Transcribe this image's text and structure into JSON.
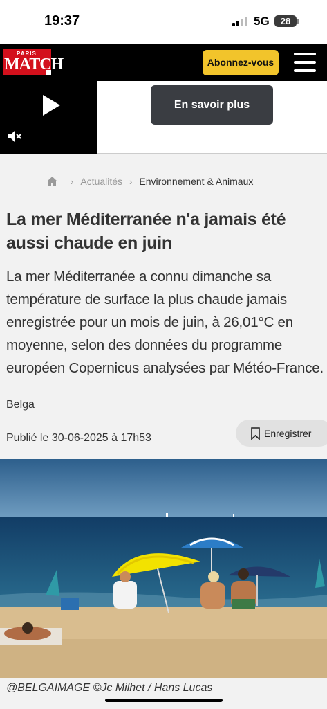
{
  "status_bar": {
    "time": "19:37",
    "network": "5G",
    "battery": "28",
    "icons": [
      "signal-icon",
      "battery-icon"
    ]
  },
  "header": {
    "logo_top": "PARIS",
    "logo_main": "MATCH",
    "subscribe_label": "Abonnez-vous",
    "menu_icon": "hamburger-menu-icon",
    "colors": {
      "background": "#000000",
      "logo": "#d3101c",
      "subscribe": "#f2c42b"
    }
  },
  "ad": {
    "learn_more_label": "En savoir plus",
    "icons": [
      "play-icon",
      "muted-speaker-icon"
    ]
  },
  "breadcrumb": {
    "home_icon": "home-icon",
    "items": [
      "Actualités",
      "Environnement & Animaux"
    ]
  },
  "article": {
    "headline": "La mer Méditerranée n'a jamais été aussi chaude en juin",
    "lead": "La mer Méditerranée a connu dimanche sa température de surface la plus chaude jamais enregistrée pour un mois de juin, à 26,01°C en moyenne, selon des données du programme européen Copernicus analysées par Météo-France.",
    "author": "Belga",
    "published": "Publié le 30-06-2025 à 17h53",
    "save_label": "Enregistrer",
    "save_icon": "bookmark-icon",
    "photo_caption": "@BELGAIMAGE ©Jc Milhet / Hans Lucas"
  }
}
